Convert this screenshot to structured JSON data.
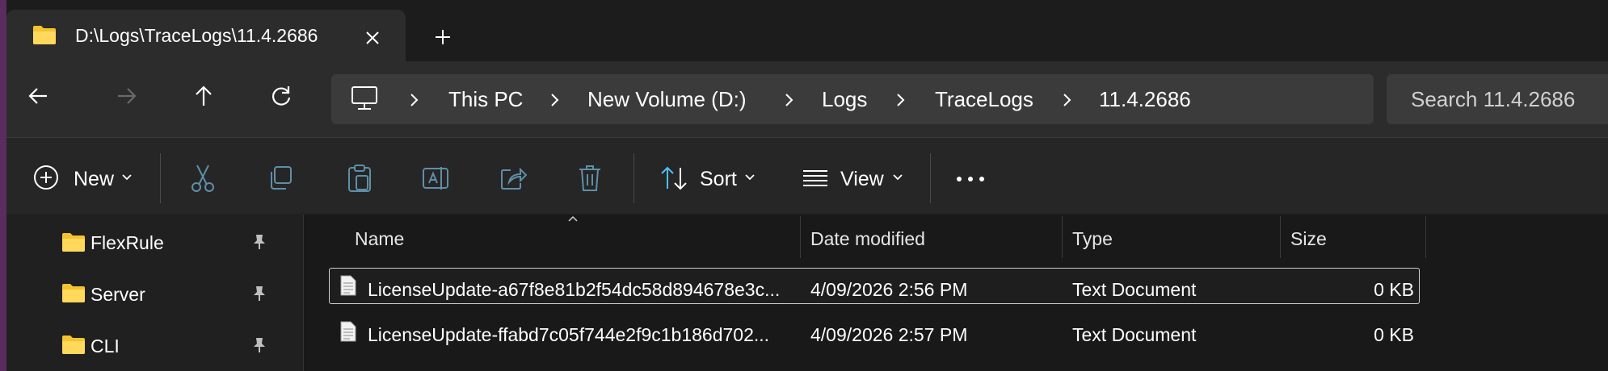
{
  "window": {
    "tab_title": "D:\\Logs\\TraceLogs\\11.4.2686"
  },
  "address_bar": {
    "breadcrumbs": [
      "This PC",
      "New Volume (D:)",
      "Logs",
      "TraceLogs",
      "11.4.2686"
    ]
  },
  "search": {
    "placeholder": "Search 11.4.2686"
  },
  "command_bar": {
    "new_label": "New",
    "sort_label": "Sort",
    "view_label": "View"
  },
  "nav_pane": {
    "items": [
      {
        "label": "FlexRule",
        "pinned": true
      },
      {
        "label": "Server",
        "pinned": true
      },
      {
        "label": "CLI",
        "pinned": true
      }
    ]
  },
  "file_list": {
    "columns": [
      "Name",
      "Date modified",
      "Type",
      "Size"
    ],
    "rows": [
      {
        "name": "LicenseUpdate-a67f8e81b2f54dc58d894678e3c...",
        "date": "4/09/2026 2:56 PM",
        "type": "Text Document",
        "size": "0 KB"
      },
      {
        "name": "LicenseUpdate-ffabd7c05f744e2f9c1b186d702...",
        "date": "4/09/2026 2:57 PM",
        "type": "Text Document",
        "size": "0 KB"
      }
    ]
  },
  "colors": {
    "accent_blue": "#4cc2ff",
    "folder_yellow": "#f4c430"
  }
}
